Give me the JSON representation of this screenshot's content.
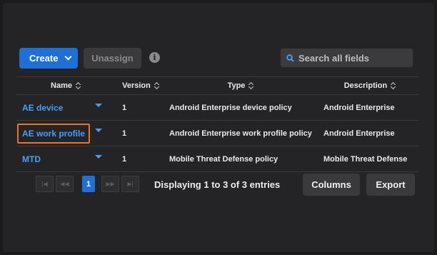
{
  "toolbar": {
    "create_label": "Create",
    "unassign_label": "Unassign",
    "info_glyph": "i",
    "search_placeholder": "Search all fields"
  },
  "table": {
    "columns": [
      "Name",
      "Version",
      "Type",
      "Description"
    ],
    "rows": [
      {
        "name": "AE device",
        "version": "1",
        "type": "Android Enterprise device policy",
        "description": "Android Enterprise",
        "selected": false
      },
      {
        "name": "AE work profile",
        "version": "1",
        "type": "Android Enterprise work profile policy",
        "description": "Android Enterprise",
        "selected": true
      },
      {
        "name": "MTD",
        "version": "1",
        "type": "Mobile Threat Defense policy",
        "description": "Mobile Threat Defense",
        "selected": false
      }
    ]
  },
  "pager": {
    "current_page": "1",
    "displaying_text": "Displaying 1 to 3 of 3 entries"
  },
  "actions": {
    "columns_label": "Columns",
    "export_label": "Export"
  },
  "colors": {
    "accent": "#1f6fd6",
    "link": "#4a9ef5",
    "selection_outline": "#e9742a"
  }
}
